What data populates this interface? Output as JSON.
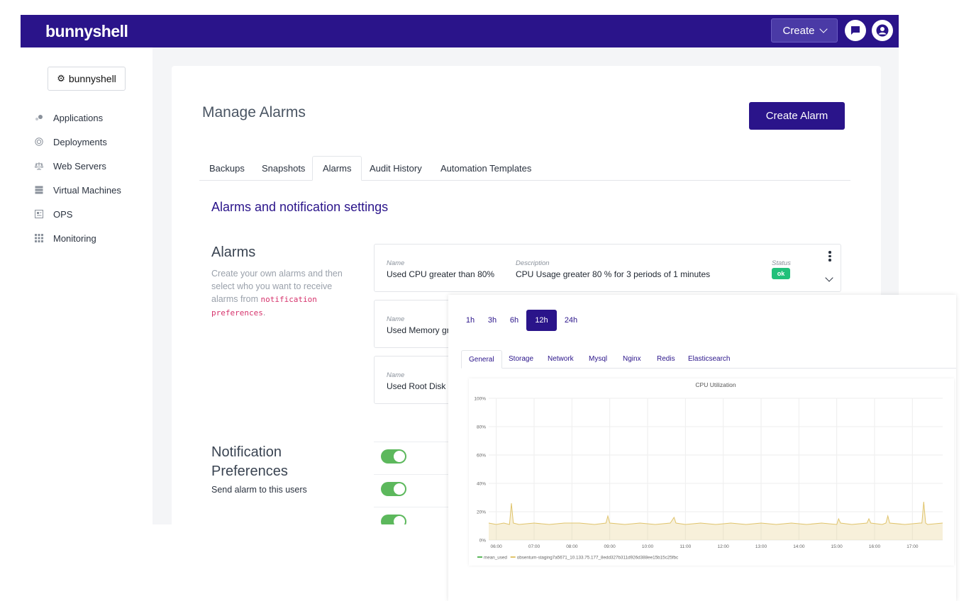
{
  "header": {
    "logo": "bunnyshell",
    "create_label": "Create"
  },
  "sidebar": {
    "org_label": "bunnyshell",
    "items": [
      {
        "label": "Applications",
        "icon": "applications-icon"
      },
      {
        "label": "Deployments",
        "icon": "deployments-icon"
      },
      {
        "label": "Web Servers",
        "icon": "scale-icon"
      },
      {
        "label": "Virtual Machines",
        "icon": "server-icon"
      },
      {
        "label": "OPS",
        "icon": "ops-icon"
      },
      {
        "label": "Monitoring",
        "icon": "grid-icon"
      }
    ]
  },
  "main": {
    "title": "Manage Alarms",
    "create_alarm_label": "Create Alarm",
    "tabs": [
      {
        "label": "Backups"
      },
      {
        "label": "Snapshots"
      },
      {
        "label": "Alarms"
      },
      {
        "label": "Audit History"
      },
      {
        "label": "Automation Templates"
      }
    ],
    "active_tab": "Alarms",
    "section_title": "Alarms and notification settings",
    "alarms": {
      "heading": "Alarms",
      "desc_text": "Create your own alarms and then select who you want to receive alarms from ",
      "desc_code": "notification preferences",
      "desc_end": ".",
      "name_label": "Name",
      "description_label": "Description",
      "status_label": "Status",
      "rows": [
        {
          "name": "Used CPU greater than 80%",
          "description": "CPU Usage greater 80 % for 3 periods of 1 minutes",
          "status": "ok"
        },
        {
          "name": "Used Memory gre"
        },
        {
          "name": "Used Root Disk gr"
        }
      ]
    },
    "notifications": {
      "heading": "Notification Preferences",
      "desc": "Send alarm to this users",
      "toggles": [
        true,
        true,
        true
      ]
    }
  },
  "monitor": {
    "ranges": [
      "1h",
      "3h",
      "6h",
      "12h",
      "24h"
    ],
    "active_range": "12h",
    "tabs": [
      "General",
      "Storage",
      "Network",
      "Mysql",
      "Nginx",
      "Redis",
      "Elasticsearch"
    ],
    "active_tab": "General",
    "colors": {
      "accent": "#2a148a",
      "series_mean": "#5cb85c",
      "series_host": "#e0c46c"
    }
  },
  "chart_data": {
    "type": "area",
    "title": "CPU Utilization",
    "xlabel": "",
    "ylabel": "",
    "x_ticks": [
      "06:00",
      "07:00",
      "08:00",
      "09:00",
      "10:00",
      "11:00",
      "12:00",
      "13:00",
      "14:00",
      "15:00",
      "16:00",
      "17:00"
    ],
    "y_ticks": [
      "0%",
      "20%",
      "40%",
      "60%",
      "80%",
      "100%"
    ],
    "ylim": [
      0,
      100
    ],
    "xlim": [
      5.8,
      17.8
    ],
    "grid": true,
    "legend": "bottom-left",
    "series": [
      {
        "name": "mean_used",
        "color": "#5cb85c",
        "values": []
      },
      {
        "name": "obsentum-staging7a5671_10.133.75.177_8edd327b311d926d388ee15b15c25fbc",
        "color": "#e0c46c",
        "x": [
          5.8,
          6.0,
          6.2,
          6.35,
          6.4,
          6.45,
          6.6,
          7.0,
          7.4,
          7.8,
          8.2,
          8.6,
          8.9,
          8.95,
          9.0,
          9.4,
          9.8,
          10.2,
          10.6,
          10.7,
          10.75,
          11.0,
          11.4,
          11.8,
          12.2,
          12.6,
          13.0,
          13.4,
          13.8,
          14.2,
          14.6,
          15.0,
          15.05,
          15.1,
          15.4,
          15.8,
          15.85,
          15.9,
          16.2,
          16.3,
          16.35,
          16.4,
          16.8,
          17.2,
          17.25,
          17.3,
          17.35,
          17.4,
          17.8
        ],
        "values": [
          12,
          11,
          12,
          11,
          26,
          12,
          11,
          12,
          11,
          12,
          12,
          11,
          12,
          17,
          12,
          11,
          12,
          11,
          12,
          16,
          12,
          11,
          12,
          11,
          12,
          11,
          12,
          11,
          12,
          11,
          12,
          11,
          15,
          12,
          11,
          12,
          15,
          12,
          11,
          12,
          17,
          12,
          11,
          12,
          12,
          27,
          12,
          11,
          12
        ]
      }
    ]
  }
}
